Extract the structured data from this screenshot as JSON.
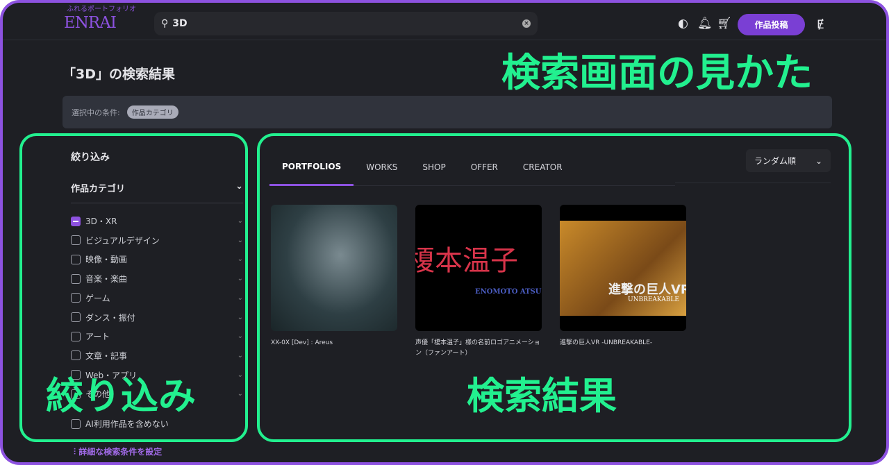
{
  "header": {
    "tagline": "ふれるポートフォリオ",
    "logo": "ENRAI",
    "search_value": "3D",
    "post_button": "作品投稿",
    "icons": [
      "shield-icon",
      "bell-icon",
      "cart-icon",
      "user-icon"
    ],
    "user_initial": "Ɇ"
  },
  "page": {
    "title": "「3D」の検索結果",
    "conditions_label": "選択中の条件:",
    "condition_chip": "作品カテゴリ"
  },
  "filter": {
    "heading": "絞り込み",
    "category": "作品カテゴリ",
    "items": [
      {
        "label": "3D・XR",
        "checked": "partial"
      },
      {
        "label": "ビジュアルデザイン"
      },
      {
        "label": "映像・動画"
      },
      {
        "label": "音楽・楽曲"
      },
      {
        "label": "ゲーム"
      },
      {
        "label": "ダンス・振付"
      },
      {
        "label": "アート"
      },
      {
        "label": "文章・記事"
      },
      {
        "label": "Web・アプリ"
      },
      {
        "label": "その他"
      }
    ],
    "exclude_ai": "AI利用作品を含めない",
    "advanced": "詳細な検索条件を設定"
  },
  "results": {
    "tabs": [
      "PORTFOLIOS",
      "WORKS",
      "SHOP",
      "OFFER",
      "CREATOR"
    ],
    "active_tab": "PORTFOLIOS",
    "sort": "ランダム順",
    "cards": [
      {
        "title": "XX-0X [Dev] : Areus"
      },
      {
        "title": "声優「榎本温子」様の名前ロゴアニメーション（ファンアート）",
        "thumb_text": "榎本温子",
        "thumb_sub": "ENOMOTO ATSUKO"
      },
      {
        "title": "進撃の巨人VR -UNBREAKABLE-",
        "thumb_text": "進撃の巨人VR",
        "thumb_sub": "UNBREAKABLE"
      }
    ]
  },
  "annotations": {
    "title": "検索画面の見かた",
    "filter": "絞り込み",
    "results": "検索結果"
  },
  "colors": {
    "accent": "#8d52e0",
    "highlight": "#22f08f",
    "bg": "#1e1f24"
  }
}
